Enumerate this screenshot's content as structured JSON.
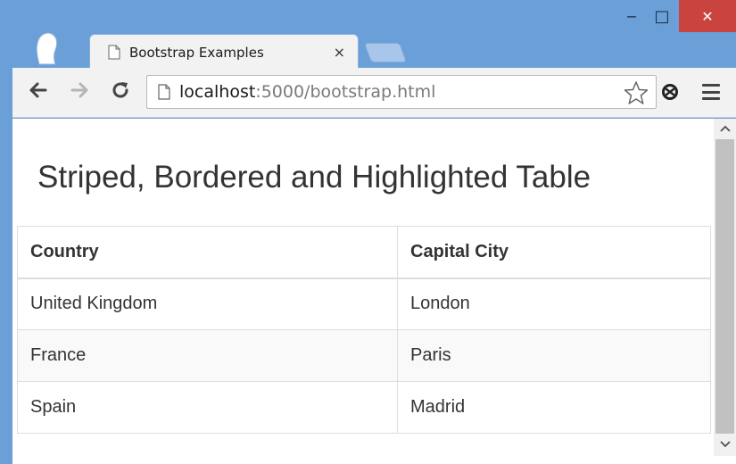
{
  "browser": {
    "tab_title": "Bootstrap Examples",
    "tab_close": "×",
    "url_host": "localhost",
    "url_path": ":5000/bootstrap.html",
    "window_controls": {
      "minimize": "‒",
      "maximize": "□",
      "close": "✕"
    }
  },
  "page": {
    "title": "Striped, Bordered and Highlighted Table",
    "table": {
      "headers": [
        "Country",
        "Capital City"
      ],
      "rows": [
        [
          "United Kingdom",
          "London"
        ],
        [
          "France",
          "Paris"
        ],
        [
          "Spain",
          "Madrid"
        ]
      ]
    }
  },
  "icons": {
    "back": "back-arrow-icon",
    "forward": "forward-arrow-icon",
    "reload": "reload-icon",
    "page": "page-icon",
    "star": "star-icon",
    "extension": "sync-extension-icon",
    "menu": "hamburger-menu-icon"
  },
  "colors": {
    "titlebar": "#6a9fd8",
    "close_button": "#c9443f",
    "stripe": "#f9f9f9",
    "border": "#dddddd"
  }
}
